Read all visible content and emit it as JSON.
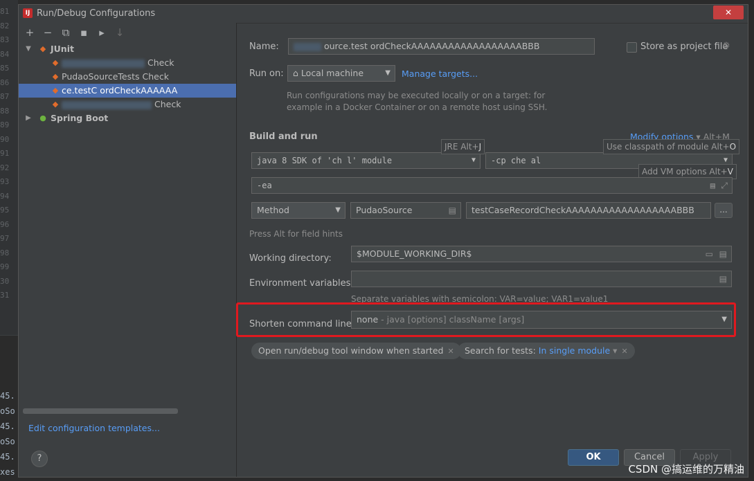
{
  "dialog": {
    "title": "Run/Debug Configurations",
    "close_glyph": "✕"
  },
  "left": {
    "toolbar": [
      "+",
      "−",
      "⧉",
      "▪",
      "▸",
      "↓"
    ],
    "tree": [
      {
        "label": "JUnit",
        "level": 0,
        "expanded": true
      },
      {
        "label": "Check",
        "level": 1
      },
      {
        "label": "PudaoSourceTests Check",
        "level": 1
      },
      {
        "label": "ce.testC ordCheckAAAAAA",
        "level": 1,
        "selected": true
      },
      {
        "label": "Check",
        "level": 1
      },
      {
        "label": "Spring Boot",
        "level": 0,
        "expanded": false
      }
    ],
    "edit_templates": "Edit configuration templates...",
    "help": "?"
  },
  "form": {
    "name_label": "Name:",
    "name_value": "ource.test ordCheckAAAAAAAAAAAAAAAAAABBB",
    "store_label": "Store as project file",
    "runon_label": "Run on:",
    "runon_value": "Local machine",
    "manage_targets": "Manage targets...",
    "runon_hint_1": "Run configurations may be executed locally or on a target: for",
    "runon_hint_2": "example in a Docker Container or on a remote host using SSH.",
    "build_title": "Build and run",
    "modify_options": "Modify options",
    "modify_shortcut": "Alt+M",
    "jre_tip": "JRE Alt+",
    "jre_key": "J",
    "cp_tip": "Use classpath of module Alt+",
    "cp_key": "O",
    "vm_tip": "Add VM options Alt+",
    "vm_key": "V",
    "jdk_value": "java 8 SDK of 'ch              l' module",
    "cp_value": "-cp che            al",
    "vm_value": "-ea",
    "method_value": "Method",
    "class_value": "PudaoSource",
    "method_name": "testCaseRecordCheckAAAAAAAAAAAAAAAAAABBB",
    "dots": "...",
    "alt_hint": "Press Alt for field hints",
    "workdir_label": "Working directory:",
    "workdir_value": "$MODULE_WORKING_DIR$",
    "env_label": "Environment variables:",
    "env_hint": "Separate variables with semicolon: VAR=value; VAR1=value1",
    "shorten_label": "Shorten command line:",
    "shorten_value": "none",
    "shorten_hint": " - java [options] className [args]",
    "chip1": "Open run/debug tool window when started",
    "chip2_label": "Search for tests: ",
    "chip2_value": "In single module"
  },
  "buttons": {
    "ok": "OK",
    "cancel": "Cancel",
    "apply": "Apply"
  },
  "gutter_lines": [
    "81",
    "82",
    "83",
    "84",
    "85",
    "86",
    "87",
    "88",
    "89",
    "90",
    "91",
    "92",
    "93",
    "94",
    "95",
    "96",
    "97",
    "98",
    "99",
    "30",
    "31"
  ],
  "console_lines": [
    "45.",
    "oSo",
    "45.",
    "oSo",
    "45.",
    "xes"
  ],
  "watermark": "CSDN @搞运维的万精油",
  "colors": {
    "selection": "#4b6eaf",
    "link": "#589df6",
    "highlight_box": "#e0191f",
    "ok_button": "#365880"
  }
}
